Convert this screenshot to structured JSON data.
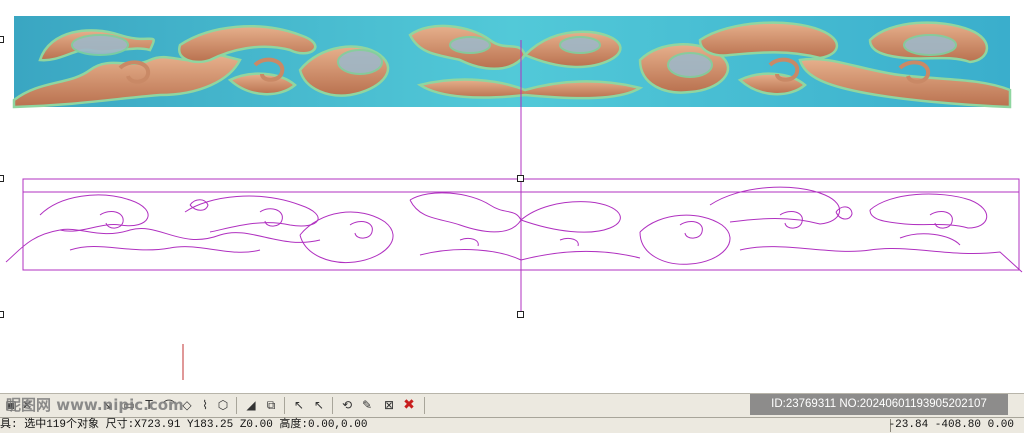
{
  "colors": {
    "relief_background": "#45bcd0",
    "relief_wood": "#c98966",
    "relief_highlight": "#8fd6a0",
    "vector_lines": "#b030c0",
    "toolbar_bg": "#ece9e0"
  },
  "toolbar": {
    "icons": [
      "box-icon",
      "cross-icon",
      "move-icon",
      "rect-icon",
      "text-icon",
      "polyline-icon",
      "node-edit-icon",
      "bezier-icon",
      "array-icon",
      "fill-icon",
      "copy-icon",
      "select-arrow-icon",
      "cut-arrow-icon",
      "transform-icon",
      "magic-icon",
      "delete-node-icon",
      "delete-icon"
    ]
  },
  "watermark": {
    "left_text": "昵图网 www.nipic.com",
    "badge_text": "ID:23769311 NO:20240601193905202107"
  },
  "status": {
    "left_text": "具: 选中119个对象 尺寸:X723.91 Y183.25 Z0.00 高度:0.00,0.00",
    "right_text": "-23.84 -408.80 0.00"
  }
}
